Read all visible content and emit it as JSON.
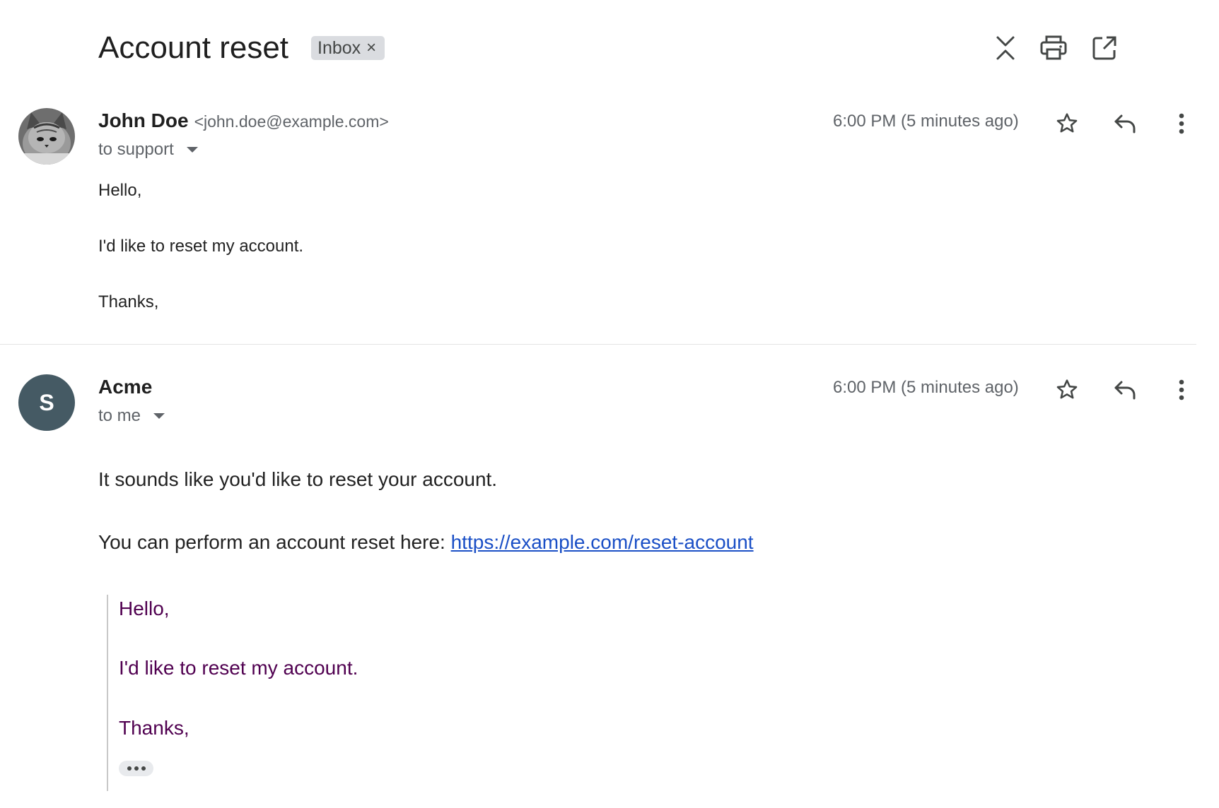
{
  "thread": {
    "subject": "Account reset",
    "label": "Inbox",
    "label_remove": "×"
  },
  "header_icons": [
    "collapse-all-icon",
    "print-icon",
    "open-in-new-window-icon"
  ],
  "messages": [
    {
      "sender_name": "John Doe",
      "sender_email": "<john.doe@example.com>",
      "recipients": "to support",
      "timestamp": "6:00 PM (5 minutes ago)",
      "avatar": "kitten-photo",
      "body": [
        "Hello,",
        "I'd like to reset my account.",
        "Thanks,"
      ]
    },
    {
      "sender_name": "Acme",
      "recipients": "to me",
      "timestamp": "6:00 PM (5 minutes ago)",
      "avatar_letter": "S",
      "avatar_color": "#455a64",
      "body_line1": "It sounds like you'd like to reset your account.",
      "body_line2_prefix": "You can perform an account reset here: ",
      "body_link": "https://example.com/reset-account",
      "quoted": [
        "Hello,",
        "I'd like to reset my account.",
        "Thanks,"
      ]
    }
  ],
  "colors": {
    "link": "#1a4fc6",
    "quoted_text": "#500050",
    "avatar_bg": "#455a64"
  }
}
